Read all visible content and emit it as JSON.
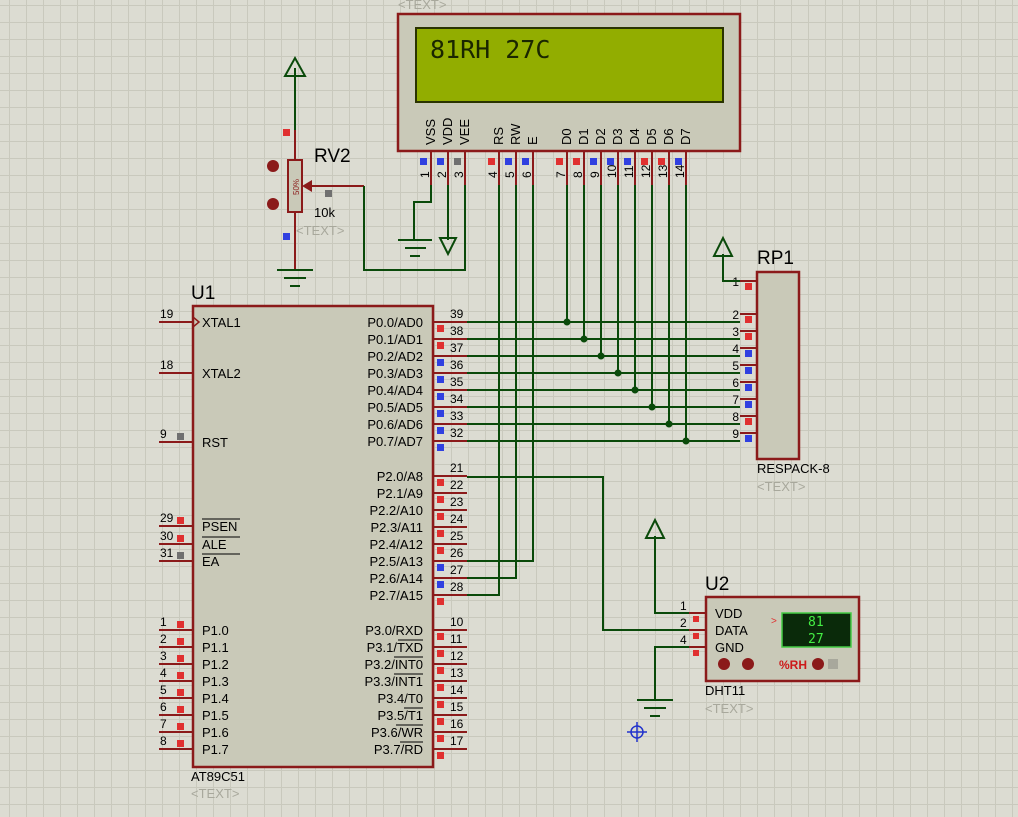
{
  "lcd": {
    "line1": "81RH  27C",
    "header_text": "<TEXT>",
    "pins": [
      {
        "name": "VSS",
        "num": "1"
      },
      {
        "name": "VDD",
        "num": "2"
      },
      {
        "name": "VEE",
        "num": "3"
      },
      {
        "name": "RS",
        "num": "4"
      },
      {
        "name": "RW",
        "num": "5"
      },
      {
        "name": "E",
        "num": "6"
      },
      {
        "name": "D0",
        "num": "7"
      },
      {
        "name": "D1",
        "num": "8"
      },
      {
        "name": "D2",
        "num": "9"
      },
      {
        "name": "D3",
        "num": "10"
      },
      {
        "name": "D4",
        "num": "11"
      },
      {
        "name": "D5",
        "num": "12"
      },
      {
        "name": "D6",
        "num": "13"
      },
      {
        "name": "D7",
        "num": "14"
      }
    ]
  },
  "rv2": {
    "ref": "RV2",
    "value": "10k",
    "percent": "50%",
    "text": "<TEXT>"
  },
  "u1": {
    "ref": "U1",
    "part": "AT89C51",
    "text": "<TEXT>",
    "left_pins": [
      {
        "num": "19",
        "name": "XTAL1"
      },
      {
        "num": "18",
        "name": "XTAL2"
      },
      {
        "num": "9",
        "name": "RST"
      },
      {
        "num": "29",
        "name": "PSEN"
      },
      {
        "num": "30",
        "name": "ALE"
      },
      {
        "num": "31",
        "name": "EA"
      },
      {
        "num": "1",
        "name": "P1.0"
      },
      {
        "num": "2",
        "name": "P1.1"
      },
      {
        "num": "3",
        "name": "P1.2"
      },
      {
        "num": "4",
        "name": "P1.3"
      },
      {
        "num": "5",
        "name": "P1.4"
      },
      {
        "num": "6",
        "name": "P1.5"
      },
      {
        "num": "7",
        "name": "P1.6"
      },
      {
        "num": "8",
        "name": "P1.7"
      }
    ],
    "right_pins": [
      {
        "num": "39",
        "name": "P0.0/AD0"
      },
      {
        "num": "38",
        "name": "P0.1/AD1"
      },
      {
        "num": "37",
        "name": "P0.2/AD2"
      },
      {
        "num": "36",
        "name": "P0.3/AD3"
      },
      {
        "num": "35",
        "name": "P0.4/AD4"
      },
      {
        "num": "34",
        "name": "P0.5/AD5"
      },
      {
        "num": "33",
        "name": "P0.6/AD6"
      },
      {
        "num": "32",
        "name": "P0.7/AD7"
      },
      {
        "num": "21",
        "name": "P2.0/A8"
      },
      {
        "num": "22",
        "name": "P2.1/A9"
      },
      {
        "num": "23",
        "name": "P2.2/A10"
      },
      {
        "num": "24",
        "name": "P2.3/A11"
      },
      {
        "num": "25",
        "name": "P2.4/A12"
      },
      {
        "num": "26",
        "name": "P2.5/A13"
      },
      {
        "num": "27",
        "name": "P2.6/A14"
      },
      {
        "num": "28",
        "name": "P2.7/A15"
      },
      {
        "num": "10",
        "name": "P3.0/RXD"
      },
      {
        "num": "11",
        "name": "P3.1/TXD"
      },
      {
        "num": "12",
        "name": "P3.2/INT0"
      },
      {
        "num": "13",
        "name": "P3.3/INT1"
      },
      {
        "num": "14",
        "name": "P3.4/T0"
      },
      {
        "num": "15",
        "name": "P3.5/T1"
      },
      {
        "num": "16",
        "name": "P3.6/WR"
      },
      {
        "num": "17",
        "name": "P3.7/RD"
      }
    ]
  },
  "rp1": {
    "ref": "RP1",
    "part": "RESPACK-8",
    "text": "<TEXT>",
    "pins": [
      "1",
      "2",
      "3",
      "4",
      "5",
      "6",
      "7",
      "8",
      "9"
    ]
  },
  "u2": {
    "ref": "U2",
    "part": "DHT11",
    "text": "<TEXT>",
    "pins": [
      {
        "num": "1",
        "name": "VDD"
      },
      {
        "num": "2",
        "name": "DATA"
      },
      {
        "num": "4",
        "name": "GND"
      }
    ],
    "humidity": "81",
    "temperature": "27",
    "mode_label": "%RH",
    "arrow": ">"
  }
}
